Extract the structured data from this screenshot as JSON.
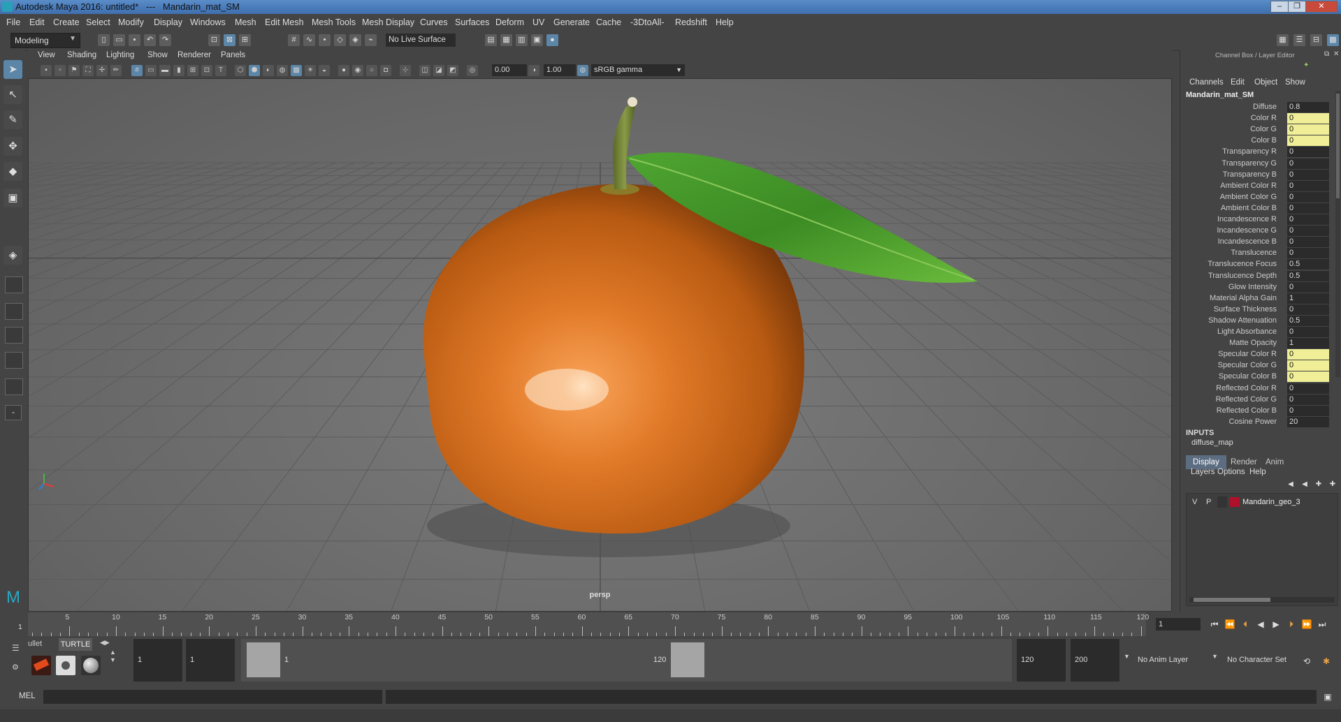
{
  "window": {
    "title": "Autodesk Maya 2016: untitled*   ---   Mandarin_mat_SM",
    "minimize": "–",
    "maximize": "❐",
    "close": "✕"
  },
  "menubar": [
    "File",
    "Edit",
    "Create",
    "Select",
    "Modify",
    "Display",
    "Windows",
    "Mesh",
    "Edit Mesh",
    "Mesh Tools",
    "Mesh Display",
    "Curves",
    "Surfaces",
    "Deform",
    "UV",
    "Generate",
    "Cache",
    "-3DtoAll-",
    "Redshift",
    "Help"
  ],
  "status": {
    "mode": "Modeling",
    "live_surface": "No Live Surface"
  },
  "viewport": {
    "menu": [
      "View",
      "Shading",
      "Lighting",
      "Show",
      "Renderer",
      "Panels"
    ],
    "exposure": "0.00",
    "gamma": "1.00",
    "color_space": "sRGB gamma",
    "camera_label": "persp"
  },
  "channel_box": {
    "header": "Channel Box / Layer Editor",
    "menu": [
      "Channels",
      "Edit",
      "Object",
      "Show"
    ],
    "node": "Mandarin_mat_SM",
    "attributes": [
      {
        "label": "Diffuse",
        "value": "0.8",
        "hl": false
      },
      {
        "label": "Color R",
        "value": "0",
        "hl": true
      },
      {
        "label": "Color G",
        "value": "0",
        "hl": true
      },
      {
        "label": "Color B",
        "value": "0",
        "hl": true
      },
      {
        "label": "Transparency R",
        "value": "0",
        "hl": false
      },
      {
        "label": "Transparency G",
        "value": "0",
        "hl": false
      },
      {
        "label": "Transparency B",
        "value": "0",
        "hl": false
      },
      {
        "label": "Ambient Color R",
        "value": "0",
        "hl": false
      },
      {
        "label": "Ambient Color G",
        "value": "0",
        "hl": false
      },
      {
        "label": "Ambient Color B",
        "value": "0",
        "hl": false
      },
      {
        "label": "Incandescence R",
        "value": "0",
        "hl": false
      },
      {
        "label": "Incandescence G",
        "value": "0",
        "hl": false
      },
      {
        "label": "Incandescence B",
        "value": "0",
        "hl": false
      },
      {
        "label": "Translucence",
        "value": "0",
        "hl": false
      },
      {
        "label": "Translucence Focus",
        "value": "0.5",
        "hl": false
      },
      {
        "label": "Translucence Depth",
        "value": "0.5",
        "hl": false
      },
      {
        "label": "Glow Intensity",
        "value": "0",
        "hl": false
      },
      {
        "label": "Material Alpha Gain",
        "value": "1",
        "hl": false
      },
      {
        "label": "Surface Thickness",
        "value": "0",
        "hl": false
      },
      {
        "label": "Shadow Attenuation",
        "value": "0.5",
        "hl": false
      },
      {
        "label": "Light Absorbance",
        "value": "0",
        "hl": false
      },
      {
        "label": "Matte Opacity",
        "value": "1",
        "hl": false
      },
      {
        "label": "Specular Color R",
        "value": "0",
        "hl": true
      },
      {
        "label": "Specular Color G",
        "value": "0",
        "hl": true
      },
      {
        "label": "Specular Color B",
        "value": "0",
        "hl": true
      },
      {
        "label": "Reflected Color R",
        "value": "0",
        "hl": false
      },
      {
        "label": "Reflected Color G",
        "value": "0",
        "hl": false
      },
      {
        "label": "Reflected Color B",
        "value": "0",
        "hl": false
      },
      {
        "label": "Cosine Power",
        "value": "20",
        "hl": false
      }
    ],
    "inputs_label": "INPUTS",
    "input_node": "diffuse_map"
  },
  "layer_editor": {
    "tabs": [
      "Display",
      "Render",
      "Anim"
    ],
    "menu": [
      "Layers",
      "Options",
      "Help"
    ],
    "layer": {
      "v": "V",
      "p": "P",
      "name": "Mandarin_geo_3",
      "color": "#b0102a"
    }
  },
  "timeline": {
    "ticks": [
      "5",
      "10",
      "15",
      "20",
      "25",
      "30",
      "35",
      "40",
      "45",
      "50",
      "55",
      "60",
      "65",
      "70",
      "75",
      "80",
      "85",
      "90",
      "95",
      "100",
      "105",
      "110",
      "115",
      "120"
    ],
    "current_frame": "1",
    "frame_field": "1"
  },
  "range": {
    "shelf_tabs": [
      "ullet",
      "TURTLE"
    ],
    "start": "1",
    "inner_start": "1",
    "slider_start": "1",
    "slider_end": "120",
    "end": "120",
    "max_end": "200",
    "anim_layer": "No Anim Layer",
    "char_set": "No Character Set"
  },
  "cmd": {
    "label": "MEL"
  }
}
